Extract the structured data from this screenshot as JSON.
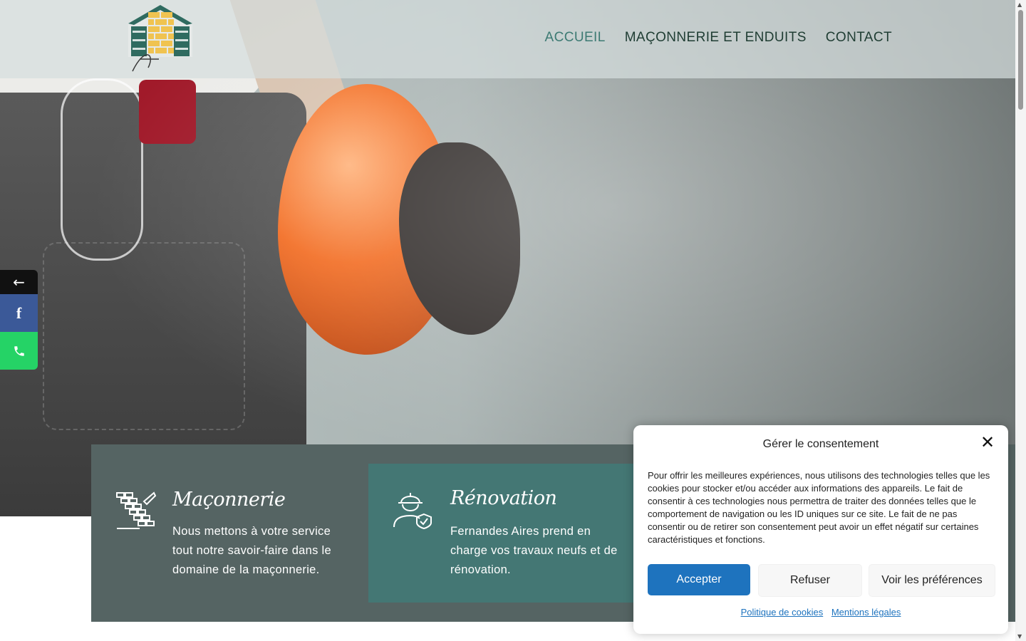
{
  "header": {
    "logo_name": "house-brick-logo",
    "nav": [
      {
        "label": "ACCUEIL",
        "active": true
      },
      {
        "label": "MAÇONNERIE ET ENDUITS",
        "active": false
      },
      {
        "label": "CONTACT",
        "active": false
      }
    ]
  },
  "social": {
    "back_icon": "arrow-left-icon",
    "facebook_icon": "facebook-icon",
    "phone_icon": "phone-icon"
  },
  "services": [
    {
      "icon": "brick-wall-icon",
      "title": "Maçonnerie",
      "text": "Nous mettons à votre service tout notre savoir-faire dans le domaine de la maçonnerie."
    },
    {
      "icon": "worker-helmet-icon",
      "title": "Rénovation",
      "text": "Fernandes Aires prend en charge vos travaux neufs et de rénovation."
    }
  ],
  "cookie": {
    "title": "Gérer le consentement",
    "text": "Pour offrir les meilleures expériences, nous utilisons des technologies telles que les cookies pour stocker et/ou accéder aux informations des appareils. Le fait de consentir à ces technologies nous permettra de traiter des données telles que le comportement de navigation ou les ID uniques sur ce site. Le fait de ne pas consentir ou de retirer son consentement peut avoir un effet négatif sur certaines caractéristiques et fonctions.",
    "accept": "Accepter",
    "refuse": "Refuser",
    "preferences": "Voir les préférences",
    "link_cookies": "Politique de cookies",
    "link_legal": "Mentions légales"
  },
  "colors": {
    "nav_text": "#1f3d33",
    "nav_active": "#3d7a73",
    "card_dark": "#556463",
    "card_teal": "#447774",
    "accept_blue": "#1e73be",
    "facebook": "#3b5998",
    "whatsapp": "#25d366"
  }
}
